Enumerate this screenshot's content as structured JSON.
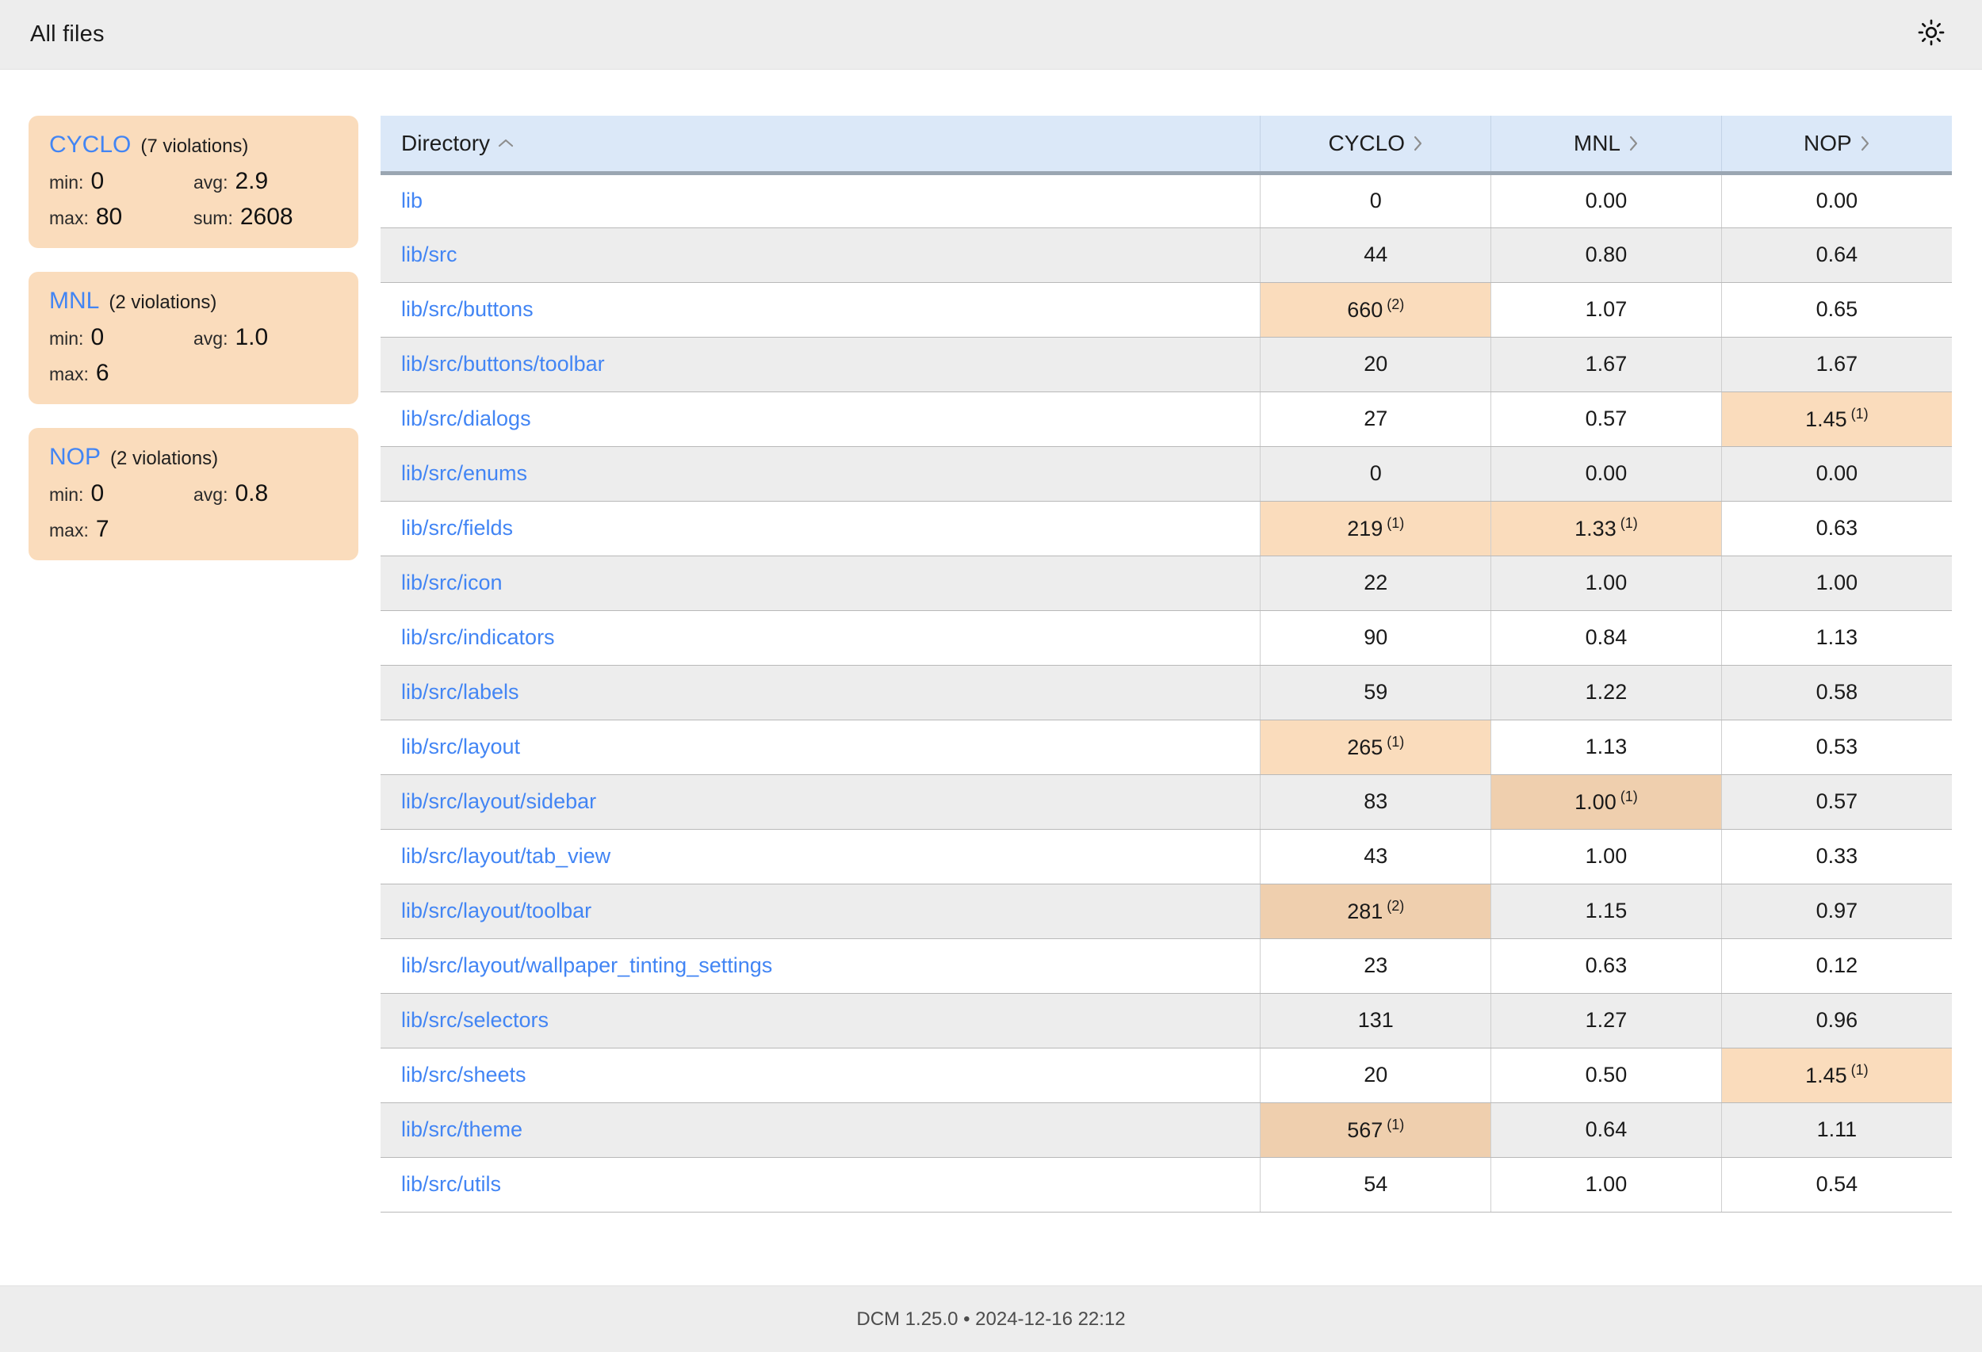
{
  "header": {
    "title": "All files",
    "theme_toggle_icon": "sun-icon"
  },
  "sidebar": {
    "cards": [
      {
        "name": "CYCLO",
        "violations": "(7 violations)",
        "stats": [
          {
            "label": "min:",
            "value": "0"
          },
          {
            "label": "avg:",
            "value": "2.9"
          },
          {
            "label": "max:",
            "value": "80"
          },
          {
            "label": "sum:",
            "value": "2608"
          }
        ]
      },
      {
        "name": "MNL",
        "violations": "(2 violations)",
        "stats": [
          {
            "label": "min:",
            "value": "0"
          },
          {
            "label": "avg:",
            "value": "1.0"
          },
          {
            "label": "max:",
            "value": "6"
          }
        ]
      },
      {
        "name": "NOP",
        "violations": "(2 violations)",
        "stats": [
          {
            "label": "min:",
            "value": "0"
          },
          {
            "label": "avg:",
            "value": "0.8"
          },
          {
            "label": "max:",
            "value": "7"
          }
        ]
      }
    ]
  },
  "table": {
    "columns": [
      {
        "label": "Directory",
        "sort_icon": "chevron-up-icon",
        "align": "left"
      },
      {
        "label": "CYCLO",
        "sort_icon": "chevron-right-icon",
        "align": "center"
      },
      {
        "label": "MNL",
        "sort_icon": "chevron-right-icon",
        "align": "center"
      },
      {
        "label": "NOP",
        "sort_icon": "chevron-right-icon",
        "align": "center"
      }
    ],
    "rows": [
      {
        "directory": "lib",
        "cyclo": {
          "value": "0",
          "sup": "",
          "hl": 0
        },
        "mnl": {
          "value": "0.00",
          "sup": "",
          "hl": 0
        },
        "nop": {
          "value": "0.00",
          "sup": "",
          "hl": 0
        }
      },
      {
        "directory": "lib/src",
        "cyclo": {
          "value": "44",
          "sup": "",
          "hl": 0
        },
        "mnl": {
          "value": "0.80",
          "sup": "",
          "hl": 0
        },
        "nop": {
          "value": "0.64",
          "sup": "",
          "hl": 0
        }
      },
      {
        "directory": "lib/src/buttons",
        "cyclo": {
          "value": "660",
          "sup": "(2)",
          "hl": 1
        },
        "mnl": {
          "value": "1.07",
          "sup": "",
          "hl": 0
        },
        "nop": {
          "value": "0.65",
          "sup": "",
          "hl": 0
        }
      },
      {
        "directory": "lib/src/buttons/toolbar",
        "cyclo": {
          "value": "20",
          "sup": "",
          "hl": 0
        },
        "mnl": {
          "value": "1.67",
          "sup": "",
          "hl": 0
        },
        "nop": {
          "value": "1.67",
          "sup": "",
          "hl": 0
        }
      },
      {
        "directory": "lib/src/dialogs",
        "cyclo": {
          "value": "27",
          "sup": "",
          "hl": 0
        },
        "mnl": {
          "value": "0.57",
          "sup": "",
          "hl": 0
        },
        "nop": {
          "value": "1.45",
          "sup": "(1)",
          "hl": 1
        }
      },
      {
        "directory": "lib/src/enums",
        "cyclo": {
          "value": "0",
          "sup": "",
          "hl": 0
        },
        "mnl": {
          "value": "0.00",
          "sup": "",
          "hl": 0
        },
        "nop": {
          "value": "0.00",
          "sup": "",
          "hl": 0
        }
      },
      {
        "directory": "lib/src/fields",
        "cyclo": {
          "value": "219",
          "sup": "(1)",
          "hl": 1
        },
        "mnl": {
          "value": "1.33",
          "sup": "(1)",
          "hl": 1
        },
        "nop": {
          "value": "0.63",
          "sup": "",
          "hl": 0
        }
      },
      {
        "directory": "lib/src/icon",
        "cyclo": {
          "value": "22",
          "sup": "",
          "hl": 0
        },
        "mnl": {
          "value": "1.00",
          "sup": "",
          "hl": 0
        },
        "nop": {
          "value": "1.00",
          "sup": "",
          "hl": 0
        }
      },
      {
        "directory": "lib/src/indicators",
        "cyclo": {
          "value": "90",
          "sup": "",
          "hl": 0
        },
        "mnl": {
          "value": "0.84",
          "sup": "",
          "hl": 0
        },
        "nop": {
          "value": "1.13",
          "sup": "",
          "hl": 0
        }
      },
      {
        "directory": "lib/src/labels",
        "cyclo": {
          "value": "59",
          "sup": "",
          "hl": 0
        },
        "mnl": {
          "value": "1.22",
          "sup": "",
          "hl": 0
        },
        "nop": {
          "value": "0.58",
          "sup": "",
          "hl": 0
        }
      },
      {
        "directory": "lib/src/layout",
        "cyclo": {
          "value": "265",
          "sup": "(1)",
          "hl": 1
        },
        "mnl": {
          "value": "1.13",
          "sup": "",
          "hl": 0
        },
        "nop": {
          "value": "0.53",
          "sup": "",
          "hl": 0
        }
      },
      {
        "directory": "lib/src/layout/sidebar",
        "cyclo": {
          "value": "83",
          "sup": "",
          "hl": 0
        },
        "mnl": {
          "value": "1.00",
          "sup": "(1)",
          "hl": 2
        },
        "nop": {
          "value": "0.57",
          "sup": "",
          "hl": 0
        }
      },
      {
        "directory": "lib/src/layout/tab_view",
        "cyclo": {
          "value": "43",
          "sup": "",
          "hl": 0
        },
        "mnl": {
          "value": "1.00",
          "sup": "",
          "hl": 0
        },
        "nop": {
          "value": "0.33",
          "sup": "",
          "hl": 0
        }
      },
      {
        "directory": "lib/src/layout/toolbar",
        "cyclo": {
          "value": "281",
          "sup": "(2)",
          "hl": 2
        },
        "mnl": {
          "value": "1.15",
          "sup": "",
          "hl": 0
        },
        "nop": {
          "value": "0.97",
          "sup": "",
          "hl": 0
        }
      },
      {
        "directory": "lib/src/layout/wallpaper_tinting_settings",
        "cyclo": {
          "value": "23",
          "sup": "",
          "hl": 0
        },
        "mnl": {
          "value": "0.63",
          "sup": "",
          "hl": 0
        },
        "nop": {
          "value": "0.12",
          "sup": "",
          "hl": 0
        }
      },
      {
        "directory": "lib/src/selectors",
        "cyclo": {
          "value": "131",
          "sup": "",
          "hl": 0
        },
        "mnl": {
          "value": "1.27",
          "sup": "",
          "hl": 0
        },
        "nop": {
          "value": "0.96",
          "sup": "",
          "hl": 0
        }
      },
      {
        "directory": "lib/src/sheets",
        "cyclo": {
          "value": "20",
          "sup": "",
          "hl": 0
        },
        "mnl": {
          "value": "0.50",
          "sup": "",
          "hl": 0
        },
        "nop": {
          "value": "1.45",
          "sup": "(1)",
          "hl": 1
        }
      },
      {
        "directory": "lib/src/theme",
        "cyclo": {
          "value": "567",
          "sup": "(1)",
          "hl": 2
        },
        "mnl": {
          "value": "0.64",
          "sup": "",
          "hl": 0
        },
        "nop": {
          "value": "1.11",
          "sup": "",
          "hl": 0
        }
      },
      {
        "directory": "lib/src/utils",
        "cyclo": {
          "value": "54",
          "sup": "",
          "hl": 0
        },
        "mnl": {
          "value": "1.00",
          "sup": "",
          "hl": 0
        },
        "nop": {
          "value": "0.54",
          "sup": "",
          "hl": 0
        }
      }
    ]
  },
  "footer": {
    "text": "DCM 1.25.0 • 2024-12-16 22:12"
  },
  "colors": {
    "link": "#4285f4",
    "card_bg": "#fadcbc",
    "header_bg": "#dbe8f8",
    "highlight_1": "#fadcbc",
    "highlight_2": "#efcfae",
    "row_alt": "#ededed",
    "chrome": "#ededed"
  }
}
